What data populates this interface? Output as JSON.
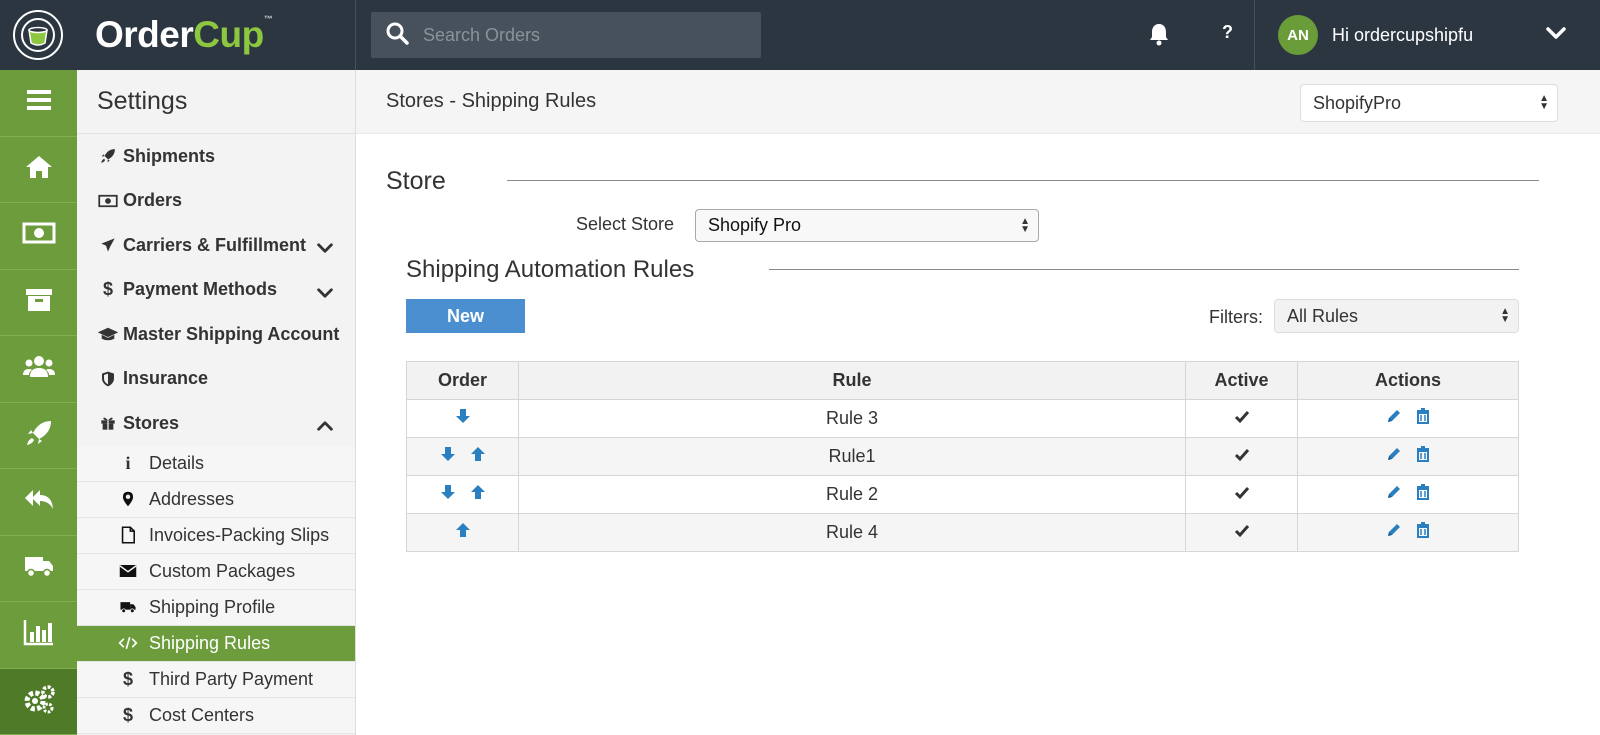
{
  "topbar": {
    "logo_order": "Order",
    "logo_cup": "Cup",
    "logo_tm": "™",
    "search_placeholder": "Search Orders",
    "help_label": "?",
    "avatar_initials": "AN",
    "greeting": "Hi ordercupshipfu"
  },
  "rail": {
    "items": [
      "menu-icon",
      "home-icon",
      "money-icon",
      "archive-icon",
      "users-icon",
      "rocket-icon",
      "reply-all-icon",
      "truck-icon",
      "bar-chart-icon",
      "gears-icon"
    ]
  },
  "sidebar": {
    "title": "Settings",
    "sections": [
      {
        "label": "Shipments"
      },
      {
        "label": "Orders"
      },
      {
        "label": "Carriers & Fulfillment"
      },
      {
        "label": "Payment Methods"
      },
      {
        "label": "Master Shipping Account"
      },
      {
        "label": "Insurance"
      },
      {
        "label": "Stores"
      }
    ],
    "store_items": [
      {
        "label": "Details"
      },
      {
        "label": "Addresses"
      },
      {
        "label": "Invoices-Packing Slips"
      },
      {
        "label": "Custom Packages"
      },
      {
        "label": "Shipping Profile"
      },
      {
        "label": "Shipping Rules"
      },
      {
        "label": "Third Party Payment"
      },
      {
        "label": "Cost Centers"
      }
    ]
  },
  "main": {
    "title": "Stores - Shipping Rules",
    "store_switch_value": "ShopifyPro",
    "store_section_title": "Store",
    "select_store_label": "Select Store",
    "select_store_value": "Shopify Pro",
    "rules_title": "Shipping Automation Rules",
    "new_button": "New",
    "filters_label": "Filters:",
    "filters_value": "All Rules",
    "table": {
      "headers": [
        "Order",
        "Rule",
        "Active",
        "Actions"
      ],
      "rows": [
        {
          "rule": "Rule 3"
        },
        {
          "rule": "Rule1"
        },
        {
          "rule": "Rule 2"
        },
        {
          "rule": "Rule 4"
        }
      ]
    }
  },
  "colors": {
    "topbar": "#2c3641",
    "rail": "#6c9c3c",
    "accent_green": "#8dc63f",
    "link_blue": "#2a7fc1",
    "button_blue": "#4b8fd1"
  }
}
